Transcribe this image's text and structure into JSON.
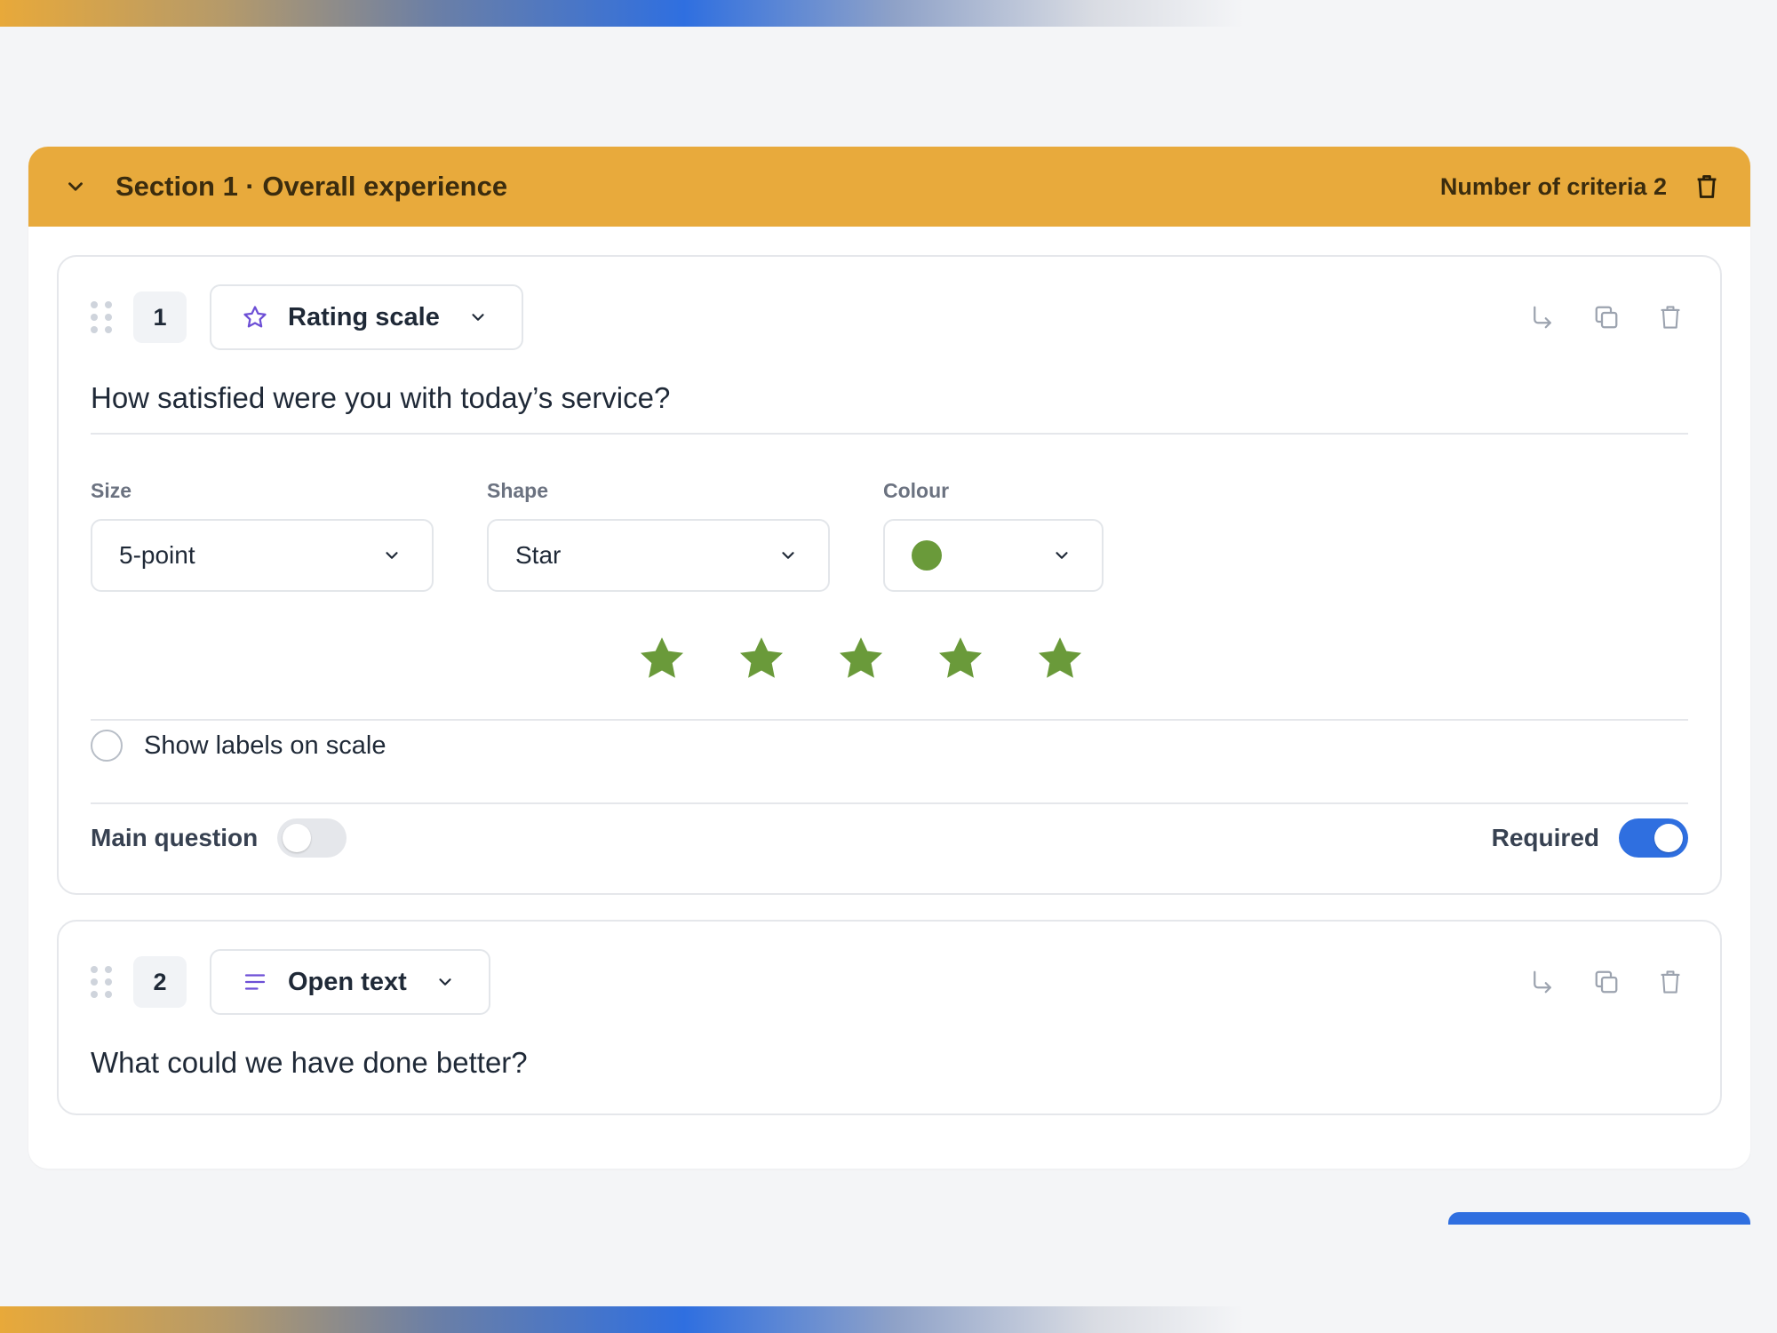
{
  "section": {
    "title": "Section 1 · Overall experience",
    "criteria_label": "Number of criteria 2",
    "header_color": "#e8aa3c"
  },
  "questions": [
    {
      "number": "1",
      "type_label": "Rating scale",
      "type_icon": "star-outline-icon",
      "text": "How satisfied were you with today’s service?",
      "fields": {
        "size": {
          "label": "Size",
          "value": "5-point"
        },
        "shape": {
          "label": "Shape",
          "value": "Star"
        },
        "colour": {
          "label": "Colour",
          "value_color": "#6a9a3a"
        }
      },
      "star_count": 5,
      "show_labels": {
        "label": "Show labels on scale",
        "checked": false
      },
      "main_question": {
        "label": "Main question",
        "on": false
      },
      "required": {
        "label": "Required",
        "on": true
      }
    },
    {
      "number": "2",
      "type_label": "Open text",
      "type_icon": "text-lines-icon",
      "text": "What could we have done better?"
    }
  ],
  "colors": {
    "accent": "#2f6fe0",
    "star": "#6a9a3a",
    "type_icon": "#6d4fd6"
  }
}
